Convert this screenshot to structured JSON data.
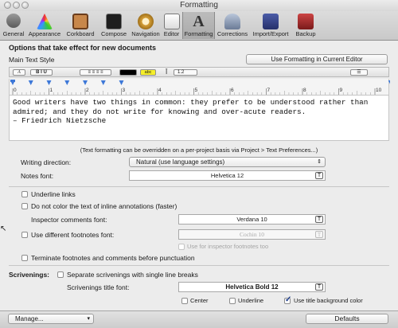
{
  "window": {
    "title": "Formatting"
  },
  "toolbar": {
    "items": [
      {
        "label": "General",
        "icon": "switch-icon",
        "color": "#6a6a6a"
      },
      {
        "label": "Appearance",
        "icon": "appearance-icon",
        "color": "#7b3fa0"
      },
      {
        "label": "Corkboard",
        "icon": "corkboard-icon",
        "color": "#b06a35"
      },
      {
        "label": "Compose",
        "icon": "compose-icon",
        "color": "#222222"
      },
      {
        "label": "Navigation",
        "icon": "compass-icon",
        "color": "#c9952a"
      },
      {
        "label": "Editor",
        "icon": "editor-icon",
        "color": "#8a8a8a"
      },
      {
        "label": "Formatting",
        "icon": "formatting-icon",
        "color": "#333333"
      },
      {
        "label": "Corrections",
        "icon": "corrections-icon",
        "color": "#5a6b8a"
      },
      {
        "label": "Import/Export",
        "icon": "import-export-icon",
        "color": "#3a4a8a"
      },
      {
        "label": "Backup",
        "icon": "backup-icon",
        "color": "#9a2b2b"
      }
    ]
  },
  "main": {
    "heading": "Options that take effect for new documents",
    "main_text_style": "Main Text Style",
    "use_formatting_button": "Use Formatting in Current Editor",
    "format_bar": {
      "style_label": "A",
      "biu": "B I U",
      "align": "≡ ≡ ≡ ≡",
      "line_spacing": "1.2",
      "highlight": "abc",
      "list": "☰"
    },
    "ruler_numbers": [
      "0",
      "1",
      "2",
      "3",
      "4",
      "5",
      "6",
      "7",
      "8",
      "9",
      "10"
    ],
    "sample_text": "Good writers have two things in common: they prefer to be understood rather than\nadmired; and they do not write for knowing and over-acute readers.\n– Friedrich Nietzsche",
    "override_note": "(Text formatting can be overridden on a per-project basis via Project > Text Preferences...)",
    "writing_direction_label": "Writing direction:",
    "writing_direction_value": "Natural (use language settings)",
    "notes_font_label": "Notes font:",
    "notes_font_value": "Helvetica 12",
    "underline_links": "Underline links",
    "no_color_annotations": "Do not color the text of inline annotations (faster)",
    "inspector_font_label": "Inspector comments font:",
    "inspector_font_value": "Verdana 10",
    "diff_footnotes_label": "Use different footnotes font:",
    "footnotes_font_value": "Cochin 10",
    "inspector_footnotes_too": "Use for inspector footnotes too",
    "terminate_label": "Terminate footnotes and comments before punctuation",
    "scrivenings_label": "Scrivenings:",
    "separate_label": "Separate scrivenings with single line breaks",
    "scrivenings_title_font_label": "Scrivenings title font:",
    "scrivenings_title_font_value": "Helvetica Bold 12",
    "center_label": "Center",
    "underline_label": "Underline",
    "title_bg_label": "Use title background  color"
  },
  "bottom": {
    "manage_label": "Manage...",
    "defaults_label": "Defaults"
  }
}
